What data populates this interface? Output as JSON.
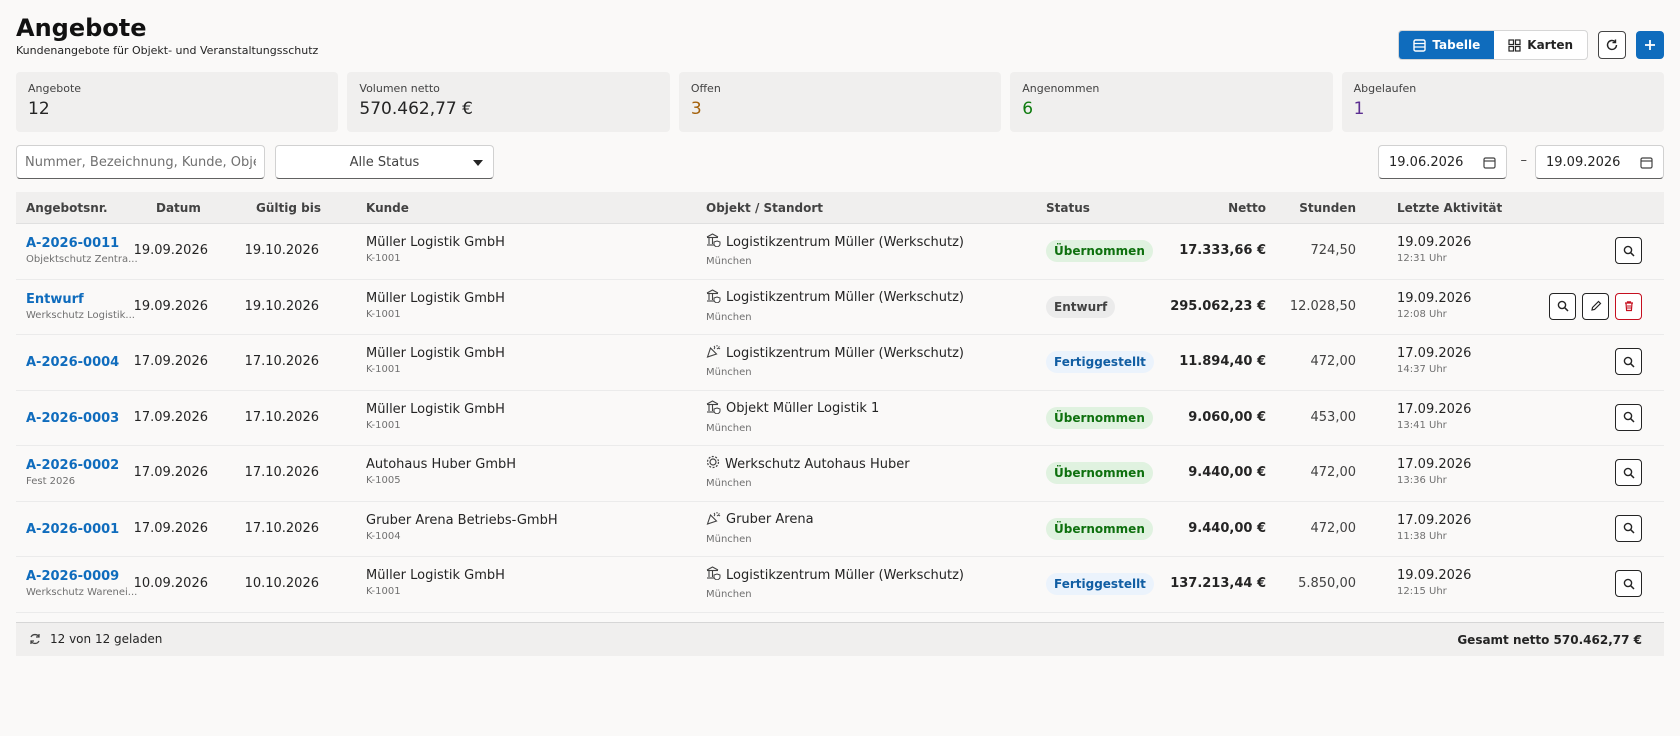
{
  "header": {
    "title": "Angebote",
    "subtitle": "Kundenangebote für Objekt- und Veranstaltungsschutz"
  },
  "toolbar": {
    "view_table_label": "Tabelle",
    "view_cards_label": "Karten",
    "active_view": "Tabelle",
    "refresh_icon": "refresh-icon",
    "add_icon": "plus-icon"
  },
  "colors": {
    "accent": "#0f6cbd",
    "offen": "#a4610b",
    "angenommen": "#107c10",
    "abgelaufen": "#5c2e91",
    "delete": "#c50f1f"
  },
  "stats": [
    {
      "label": "Angebote",
      "value": "12"
    },
    {
      "label": "Volumen netto",
      "value": "570.462,77 €"
    },
    {
      "label": "Offen",
      "value": "3"
    },
    {
      "label": "Angenommen",
      "value": "6"
    },
    {
      "label": "Abgelaufen",
      "value": "1"
    }
  ],
  "filters": {
    "search_placeholder": "Nummer, Bezeichnung, Kunde, Objekt",
    "status_value": "Alle Status",
    "date_from": "19.06.2026",
    "date_sep": "–",
    "date_to": "19.09.2026"
  },
  "table": {
    "columns": [
      "Angebotsnr.",
      "Datum",
      "Gültig bis",
      "Kunde",
      "Objekt / Standort",
      "Status",
      "Netto",
      "Stunden",
      "Letzte Aktivität"
    ],
    "rows": [
      {
        "nr": "A-2026-0011",
        "sub": "Objektschutz Zentra...",
        "datum": "19.09.2026",
        "gueltig": "19.10.2026",
        "kunde": "Müller Logistik GmbH",
        "kunde_nr": "K-1001",
        "objekt_icon": "building-shield-icon",
        "objekt": "Logistikzentrum Müller (Werkschutz)",
        "stadt": "München",
        "status": "Übernommen",
        "netto": "17.333,66 €",
        "stunden": "724,50",
        "akt_date": "19.09.2026",
        "akt_time": "12:31 Uhr"
      },
      {
        "nr": "Entwurf",
        "sub": "Werkschutz Logistik...",
        "datum": "19.09.2026",
        "gueltig": "19.10.2026",
        "kunde": "Müller Logistik GmbH",
        "kunde_nr": "K-1001",
        "objekt_icon": "building-shield-icon",
        "objekt": "Logistikzentrum Müller (Werkschutz)",
        "stadt": "München",
        "status": "Entwurf",
        "netto": "295.062,23 €",
        "stunden": "12.028,50",
        "akt_date": "19.09.2026",
        "akt_time": "12:08 Uhr"
      },
      {
        "nr": "A-2026-0004",
        "sub": "",
        "datum": "17.09.2026",
        "gueltig": "17.10.2026",
        "kunde": "Müller Logistik GmbH",
        "kunde_nr": "K-1001",
        "objekt_icon": "party-popper-icon",
        "objekt": "Logistikzentrum Müller (Werkschutz)",
        "stadt": "München",
        "status": "Fertiggestellt",
        "netto": "11.894,40 €",
        "stunden": "472,00",
        "akt_date": "17.09.2026",
        "akt_time": "14:37 Uhr"
      },
      {
        "nr": "A-2026-0003",
        "sub": "",
        "datum": "17.09.2026",
        "gueltig": "17.10.2026",
        "kunde": "Müller Logistik GmbH",
        "kunde_nr": "K-1001",
        "objekt_icon": "building-shield-icon",
        "objekt": "Objekt Müller Logistik 1",
        "stadt": "München",
        "status": "Übernommen",
        "netto": "9.060,00 €",
        "stunden": "453,00",
        "akt_date": "17.09.2026",
        "akt_time": "13:41 Uhr"
      },
      {
        "nr": "A-2026-0002",
        "sub": "Fest 2026",
        "datum": "17.09.2026",
        "gueltig": "17.10.2026",
        "kunde": "Autohaus Huber GmbH",
        "kunde_nr": "K-1005",
        "objekt_icon": "factory-gear-icon",
        "objekt": "Werkschutz Autohaus Huber",
        "stadt": "München",
        "status": "Übernommen",
        "netto": "9.440,00 €",
        "stunden": "472,00",
        "akt_date": "17.09.2026",
        "akt_time": "13:36 Uhr"
      },
      {
        "nr": "A-2026-0001",
        "sub": "",
        "datum": "17.09.2026",
        "gueltig": "17.10.2026",
        "kunde": "Gruber Arena Betriebs-GmbH",
        "kunde_nr": "K-1004",
        "objekt_icon": "party-popper-icon",
        "objekt": "Gruber Arena",
        "stadt": "München",
        "status": "Übernommen",
        "netto": "9.440,00 €",
        "stunden": "472,00",
        "akt_date": "17.09.2026",
        "akt_time": "11:38 Uhr"
      },
      {
        "nr": "A-2026-0009",
        "sub": "Werkschutz Warenei...",
        "datum": "10.09.2026",
        "gueltig": "10.10.2026",
        "kunde": "Müller Logistik GmbH",
        "kunde_nr": "K-1001",
        "objekt_icon": "building-shield-icon",
        "objekt": "Logistikzentrum Müller (Werkschutz)",
        "stadt": "München",
        "status": "Fertiggestellt",
        "netto": "137.213,44 €",
        "stunden": "5.850,00",
        "akt_date": "19.09.2026",
        "akt_time": "12:15 Uhr"
      }
    ]
  },
  "footer": {
    "loaded_text": "12 von 12 geladen",
    "total_text": "Gesamt netto 570.462,77 €"
  }
}
